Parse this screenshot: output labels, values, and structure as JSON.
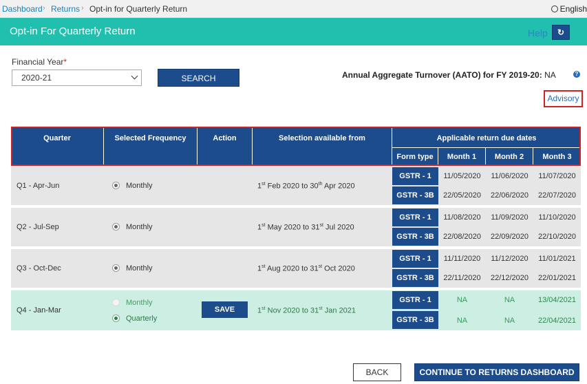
{
  "breadcrumb": {
    "items": [
      "Dashboard",
      "Returns",
      "Opt-in for Quarterly Return"
    ],
    "separator": "›"
  },
  "language": "English",
  "banner": {
    "title": "Opt-in For Quarterly Return",
    "help": "Help",
    "refresh_icon": "↻"
  },
  "form": {
    "fy_label": "Financial Year",
    "required_mark": "*",
    "fy_value": "2020-21",
    "search_label": "SEARCH"
  },
  "aato": {
    "label": "Annual Aggregate Turnover (AATO) for FY 2019-20:",
    "value": "NA",
    "info_icon": "?"
  },
  "advisory": "Advisory",
  "table": {
    "headers": {
      "quarter": "Quarter",
      "frequency": "Selected Frequency",
      "action": "Action",
      "selection": "Selection available from",
      "applicable": "Applicable return due dates",
      "form_type": "Form type",
      "month1": "Month 1",
      "month2": "Month 2",
      "month3": "Month 3"
    },
    "rows": [
      {
        "quarter": "Q1 - Apr-Jun",
        "freq": "Monthly",
        "sel_from_day": "1",
        "sel_from_sup": "st",
        "sel_from_rest": " Feb 2020 to ",
        "sel_to_day": "30",
        "sel_to_sup": "th",
        "sel_to_rest": " Apr 2020",
        "gstr1": "GSTR - 1",
        "gstr3b": "GSTR - 3B",
        "g1": [
          "11/05/2020",
          "11/06/2020",
          "11/07/2020"
        ],
        "g3": [
          "22/05/2020",
          "22/06/2020",
          "22/07/2020"
        ]
      },
      {
        "quarter": "Q2 - Jul-Sep",
        "freq": "Monthly",
        "sel_from_day": "1",
        "sel_from_sup": "st",
        "sel_from_rest": " May 2020 to ",
        "sel_to_day": "31",
        "sel_to_sup": "st",
        "sel_to_rest": " Jul 2020",
        "gstr1": "GSTR - 1",
        "gstr3b": "GSTR - 3B",
        "g1": [
          "11/08/2020",
          "11/09/2020",
          "11/10/2020"
        ],
        "g3": [
          "22/08/2020",
          "22/09/2020",
          "22/10/2020"
        ]
      },
      {
        "quarter": "Q3 - Oct-Dec",
        "freq": "Monthly",
        "sel_from_day": "1",
        "sel_from_sup": "st",
        "sel_from_rest": " Aug 2020 to ",
        "sel_to_day": "31",
        "sel_to_sup": "st",
        "sel_to_rest": " Oct 2020",
        "gstr1": "GSTR - 1",
        "gstr3b": "GSTR - 3B",
        "g1": [
          "11/11/2020",
          "11/12/2020",
          "11/01/2021"
        ],
        "g3": [
          "22/11/2020",
          "22/12/2020",
          "22/01/2021"
        ]
      },
      {
        "quarter": "Q4 - Jan-Mar",
        "freq_monthly": "Monthly",
        "freq_quarterly": "Quarterly",
        "save_label": "SAVE",
        "sel_from_day": "1",
        "sel_from_sup": "st",
        "sel_from_rest": " Nov 2020 to ",
        "sel_to_day": "31",
        "sel_to_sup": "st",
        "sel_to_rest": " Jan 2021",
        "gstr1": "GSTR - 1",
        "gstr3b": "GSTR - 3B",
        "g1": [
          "NA",
          "NA",
          "13/04/2021"
        ],
        "g3": [
          "NA",
          "NA",
          "22/04/2021"
        ]
      }
    ]
  },
  "footer": {
    "back_label": "BACK",
    "continue_label": "CONTINUE TO RETURNS DASHBOARD"
  },
  "colors": {
    "banner": "#20bfae",
    "primary_button": "#1c4c8c",
    "highlight_border": "#d32020",
    "selected_row": "#cdeee2"
  }
}
